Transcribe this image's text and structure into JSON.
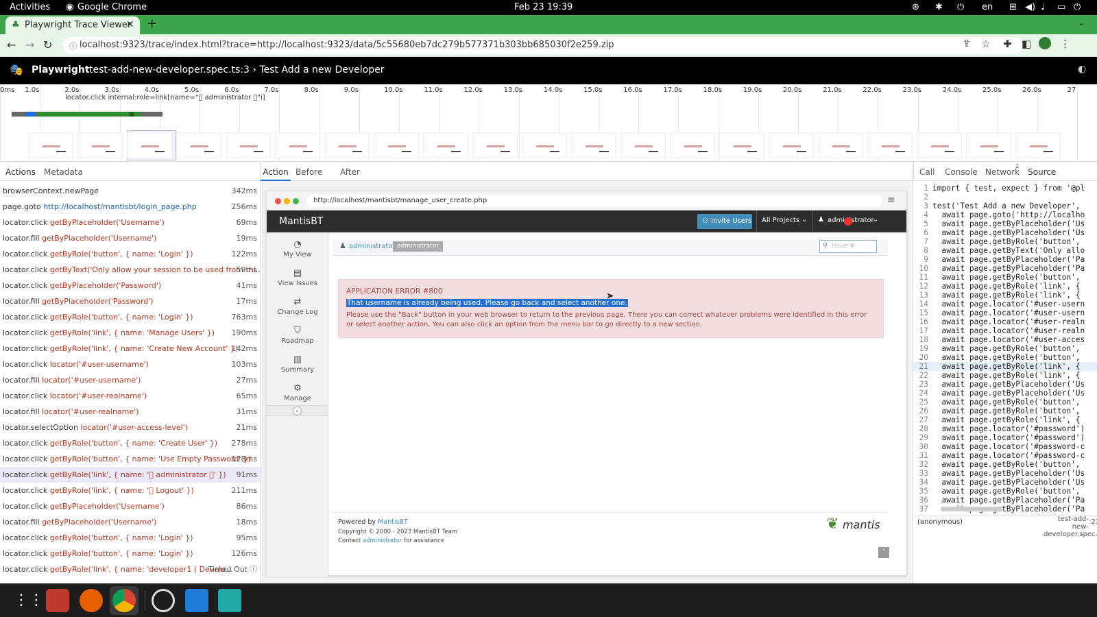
{
  "system": {
    "activities": "Activities",
    "app_name": "Google Chrome",
    "clock": "Feb 23  19:39",
    "lang": "en"
  },
  "browser": {
    "tab_title": "Playwright Trace Viewer",
    "url": "localhost:9323/trace/index.html?trace=http://localhost:9323/data/5c55680eb7dc279b577371b303bb685030f2e259.zip"
  },
  "playwright": {
    "brand": "Playwright",
    "title": "test-add-new-developer.spec.ts:3 › Test Add a new Developer"
  },
  "timeline": {
    "ticks": [
      "0ms",
      "1.0s",
      "2.0s",
      "3.0s",
      "4.0s",
      "5.0s",
      "6.0s",
      "7.0s",
      "8.0s",
      "9.0s",
      "10.0s",
      "11.0s",
      "12.0s",
      "13.0s",
      "14.0s",
      "15.0s",
      "16.0s",
      "17.0s",
      "18.0s",
      "19.0s",
      "20.0s",
      "21.0s",
      "22.0s",
      "23.0s",
      "24.0s",
      "25.0s",
      "26.0s",
      "27"
    ],
    "hover_label": "locator.click internal:role=link[name=\" administrator \"i]"
  },
  "left_tabs": {
    "actions": "Actions",
    "metadata": "Metadata"
  },
  "actions": [
    {
      "method": "browserContext.newPage",
      "selector": "",
      "duration": "342ms"
    },
    {
      "method": "page.goto",
      "selector": "http://localhost/mantisbt/login_page.php",
      "duration": "256ms",
      "url": true
    },
    {
      "method": "locator.click",
      "selector": "getByPlaceholder('Username')",
      "duration": "69ms"
    },
    {
      "method": "locator.fill",
      "selector": "getByPlaceholder('Username')",
      "duration": "19ms"
    },
    {
      "method": "locator.click",
      "selector": "getByRole('button', { name: 'Login' })",
      "duration": "122ms"
    },
    {
      "method": "locator.click",
      "selector": "getByText('Only allow your session to be used from thi...",
      "duration": "59ms"
    },
    {
      "method": "locator.click",
      "selector": "getByPlaceholder('Password')",
      "duration": "41ms"
    },
    {
      "method": "locator.fill",
      "selector": "getByPlaceholder('Password')",
      "duration": "17ms"
    },
    {
      "method": "locator.click",
      "selector": "getByRole('button', { name: 'Login' })",
      "duration": "763ms"
    },
    {
      "method": "locator.click",
      "selector": "getByRole('link', { name: 'Manage Users' })",
      "duration": "190ms"
    },
    {
      "method": "locator.click",
      "selector": "getByRole('link', { name: 'Create New Account' })",
      "duration": "142ms"
    },
    {
      "method": "locator.click",
      "selector": "locator('#user-username')",
      "duration": "103ms"
    },
    {
      "method": "locator.fill",
      "selector": "locator('#user-username')",
      "duration": "27ms"
    },
    {
      "method": "locator.click",
      "selector": "locator('#user-realname')",
      "duration": "65ms"
    },
    {
      "method": "locator.fill",
      "selector": "locator('#user-realname')",
      "duration": "31ms"
    },
    {
      "method": "locator.selectOption",
      "selector": "locator('#user-access-level')",
      "duration": "21ms"
    },
    {
      "method": "locator.click",
      "selector": "getByRole('button', { name: 'Create User' })",
      "duration": "278ms"
    },
    {
      "method": "locator.click",
      "selector": "getByRole('button', { name: 'Use Empty Password' })",
      "duration": "128ms"
    },
    {
      "method": "locator.click",
      "selector": "getByRole('link', { name: ' administrator ' })",
      "duration": "91ms",
      "selected": true
    },
    {
      "method": "locator.click",
      "selector": "getByRole('link', { name: ' Logout' })",
      "duration": "211ms"
    },
    {
      "method": "locator.click",
      "selector": "getByPlaceholder('Username')",
      "duration": "86ms"
    },
    {
      "method": "locator.fill",
      "selector": "getByPlaceholder('Username')",
      "duration": "18ms"
    },
    {
      "method": "locator.click",
      "selector": "getByRole('button', { name: 'Login' })",
      "duration": "95ms"
    },
    {
      "method": "locator.click",
      "selector": "getByRole('button', { name: 'Login' })",
      "duration": "126ms"
    },
    {
      "method": "locator.click",
      "selector": "getByRole('link', { name: 'developer1 ( Develo...",
      "duration": "Timed Out"
    }
  ],
  "mid_tabs": {
    "action": "Action",
    "before": "Before",
    "after": "After"
  },
  "snapshot": {
    "url": "http://localhost/mantisbt/manage_user_create.php",
    "brand": "MantisBT",
    "invite": "Invite Users",
    "projects": "All Projects",
    "user_menu": "administrator",
    "sidebar": [
      {
        "label": "My View",
        "icon": "dashboard-icon"
      },
      {
        "label": "View Issues",
        "icon": "list-icon"
      },
      {
        "label": "Change Log",
        "icon": "retweet-icon"
      },
      {
        "label": "Roadmap",
        "icon": "road-icon"
      },
      {
        "label": "Summary",
        "icon": "bar-chart-icon"
      },
      {
        "label": "Manage",
        "icon": "gears-icon"
      }
    ],
    "crumb_user": "administrator",
    "crumb_badge": "administrator",
    "issue_placeholder": "Issue #",
    "error_title": "APPLICATION ERROR #800",
    "error_highlight": "That username is already being used. Please go back and select another one.",
    "error_text": "Please use the \"Back\" button in your web browser to return to the previous page. There you can correct whatever problems were identified in this error or select another action. You can also click an option from the menu bar to go directly to a new section.",
    "powered_by": "Powered by",
    "powered_link": "MantisBT",
    "copyright": "Copyright © 2000 - 2023 MantisBT Team",
    "contact_pre": "Contact",
    "contact_link": "administrator",
    "contact_post": "for assistance",
    "logo": "mantis"
  },
  "right_tabs": {
    "call": "Call",
    "console": "Console",
    "network": "Network",
    "network_badge": "2",
    "source": "Source"
  },
  "source": [
    {
      "n": "1",
      "code": "import { test, expect } from '@pl"
    },
    {
      "n": "2",
      "code": ""
    },
    {
      "n": "3",
      "code": "test('Test Add a new Developer',"
    },
    {
      "n": "4",
      "code": "  await page.goto('http://localho"
    },
    {
      "n": "5",
      "code": "  await page.getByPlaceholder('Us"
    },
    {
      "n": "6",
      "code": "  await page.getByPlaceholder('Us"
    },
    {
      "n": "7",
      "code": "  await page.getByRole('button',"
    },
    {
      "n": "8",
      "code": "  await page.getByText('Only allo"
    },
    {
      "n": "9",
      "code": "  await page.getByPlaceholder('Pa"
    },
    {
      "n": "10",
      "code": "  await page.getByPlaceholder('Pa"
    },
    {
      "n": "11",
      "code": "  await page.getByRole('button',"
    },
    {
      "n": "12",
      "code": "  await page.getByRole('link', {"
    },
    {
      "n": "13",
      "code": "  await page.getByRole('link', {"
    },
    {
      "n": "14",
      "code": "  await page.locator('#user-usern"
    },
    {
      "n": "15",
      "code": "  await page.locator('#user-usern"
    },
    {
      "n": "16",
      "code": "  await page.locator('#user-realn"
    },
    {
      "n": "17",
      "code": "  await page.locator('#user-realn"
    },
    {
      "n": "18",
      "code": "  await page.locator('#user-acces"
    },
    {
      "n": "19",
      "code": "  await page.getByRole('button',"
    },
    {
      "n": "20",
      "code": "  await page.getByRole('button',"
    },
    {
      "n": "21",
      "code": "  await page.getByRole('link', {",
      "hl": true
    },
    {
      "n": "22",
      "code": "  await page.getByRole('link', {"
    },
    {
      "n": "23",
      "code": "  await page.getByPlaceholder('Us"
    },
    {
      "n": "24",
      "code": "  await page.getByPlaceholder('Us"
    },
    {
      "n": "25",
      "code": "  await page.getByRole('button',"
    },
    {
      "n": "26",
      "code": "  await page.getByRole('button',"
    },
    {
      "n": "27",
      "code": "  await page.getByRole('link', {"
    },
    {
      "n": "28",
      "code": "  await page.locator('#password')"
    },
    {
      "n": "29",
      "code": "  await page.locator('#password')"
    },
    {
      "n": "30",
      "code": "  await page.locator('#password-c"
    },
    {
      "n": "31",
      "code": "  await page.locator('#password-c"
    },
    {
      "n": "32",
      "code": "  await page.getByRole('button',"
    },
    {
      "n": "33",
      "code": "  await page.getByPlaceholder('Us"
    },
    {
      "n": "34",
      "code": "  await page.getByPlaceholder('Us"
    },
    {
      "n": "35",
      "code": "  await page.getByRole('button',"
    },
    {
      "n": "36",
      "code": "  await page.getByPlaceholder('Pa"
    },
    {
      "n": "37",
      "code": "  await page.getByPlaceholder('Pa"
    }
  ],
  "stack": {
    "fn": "(anonymous)",
    "file": "test-add-new-developer.spec.ts",
    "line": ":21"
  },
  "colors": {
    "chrome_green": "#3ea64a",
    "error_bg": "#f2dede",
    "link": "#1a5fb4",
    "selector_red": "#b5341d",
    "mantis_blue": "#438eb9"
  },
  "dock": [
    "apps-grid-icon",
    "dbeaver-icon",
    "firefox-icon",
    "chrome-icon",
    "obs-icon",
    "vscode-icon",
    "vscode-insiders-icon"
  ]
}
